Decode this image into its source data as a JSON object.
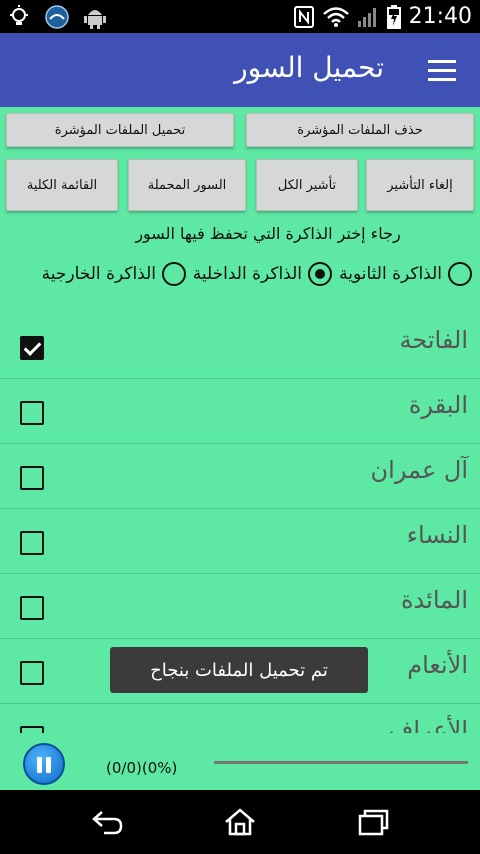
{
  "status_bar": {
    "time": "21:40",
    "icons": [
      "bulb-icon",
      "quran-app-icon",
      "android-icon",
      "nfc-icon",
      "wifi-icon",
      "signal-icon",
      "battery-charging-icon"
    ]
  },
  "app_bar": {
    "title": "تحميل السور",
    "menu_icon": "hamburger-menu-icon"
  },
  "buttons": {
    "delete_marked": "حذف الملفات المؤشرة",
    "download_marked": "تحميل الملفات المؤشرة",
    "unmark": "إلغاء التأشير",
    "mark_all": "تأشير الكل",
    "downloaded_surahs": "السور المحملة",
    "full_list": "القائمة الكلية"
  },
  "storage_prompt": "رجاء إختر الذاكرة التي تحفظ فيها السور",
  "storage_options": [
    {
      "label": "الذاكرة الثانوية",
      "selected": false
    },
    {
      "label": "الذاكرة الداخلية",
      "selected": true
    },
    {
      "label": "الذاكرة الخارجية",
      "selected": false
    }
  ],
  "surahs": [
    {
      "name": "الفاتحة",
      "checked": true
    },
    {
      "name": "البقرة",
      "checked": false
    },
    {
      "name": "آل عمران",
      "checked": false
    },
    {
      "name": "النساء",
      "checked": false
    },
    {
      "name": "المائدة",
      "checked": false
    },
    {
      "name": "الأنعام",
      "checked": false
    },
    {
      "name": "الأعراف",
      "checked": false
    }
  ],
  "toast": "تم تحميل الملفات بنجاح",
  "player": {
    "progress_text": "(0/0)(0%)",
    "progress_fraction": 0
  },
  "nav_bar": {
    "icons": [
      "back-icon",
      "home-icon",
      "recent-apps-icon"
    ]
  },
  "colors": {
    "background": "#5de9a3",
    "app_bar": "#3f51b5",
    "button": "#d6d7d7",
    "toast": "#3b3b3b"
  }
}
